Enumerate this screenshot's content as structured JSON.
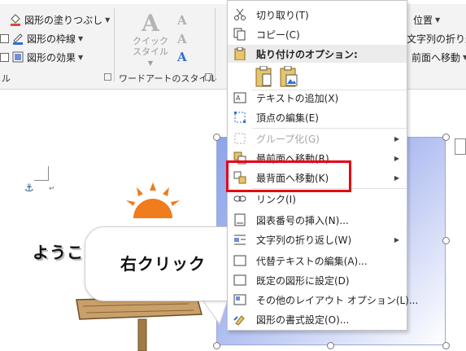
{
  "ribbon": {
    "shape_fill": "図形の塗りつぶし",
    "shape_outline": "図形の枠線",
    "shape_effect": "図形の効果",
    "quick_style_line1": "クイック",
    "quick_style_line2": "スタイル",
    "wordart_group": "ワードアートのスタイル",
    "left_group_suffix": "ル",
    "position": "位置",
    "wrap_text": "文字列の折り返",
    "bring_forward": "前面へ移動"
  },
  "menu": {
    "cut": "切り取り(T)",
    "copy": "コピー(C)",
    "paste_options": "貼り付けのオプション:",
    "add_text": "テキストの追加(X)",
    "edit_points": "頂点の編集(E)",
    "group": "グループ化(G)",
    "bring_front": "最前面へ移動(R)",
    "send_back": "最背面へ移動(K)",
    "link": "リンク(I)",
    "insert_caption": "図表番号の挿入(N)...",
    "wrap_text": "文字列の折り返し(W)",
    "edit_alt_text": "代替テキストの編集(A)...",
    "set_default": "既定の図形に設定(D)",
    "more_layout": "その他のレイアウト オプション(L)...",
    "format_shape": "図形の書式設定(O)..."
  },
  "document": {
    "welcome": "ようこ",
    "callout": "右クリック"
  },
  "colors": {
    "highlight": "#e60012",
    "accent": "#2b579a",
    "sun": "#f07c1e",
    "wood": "#b58a52"
  }
}
